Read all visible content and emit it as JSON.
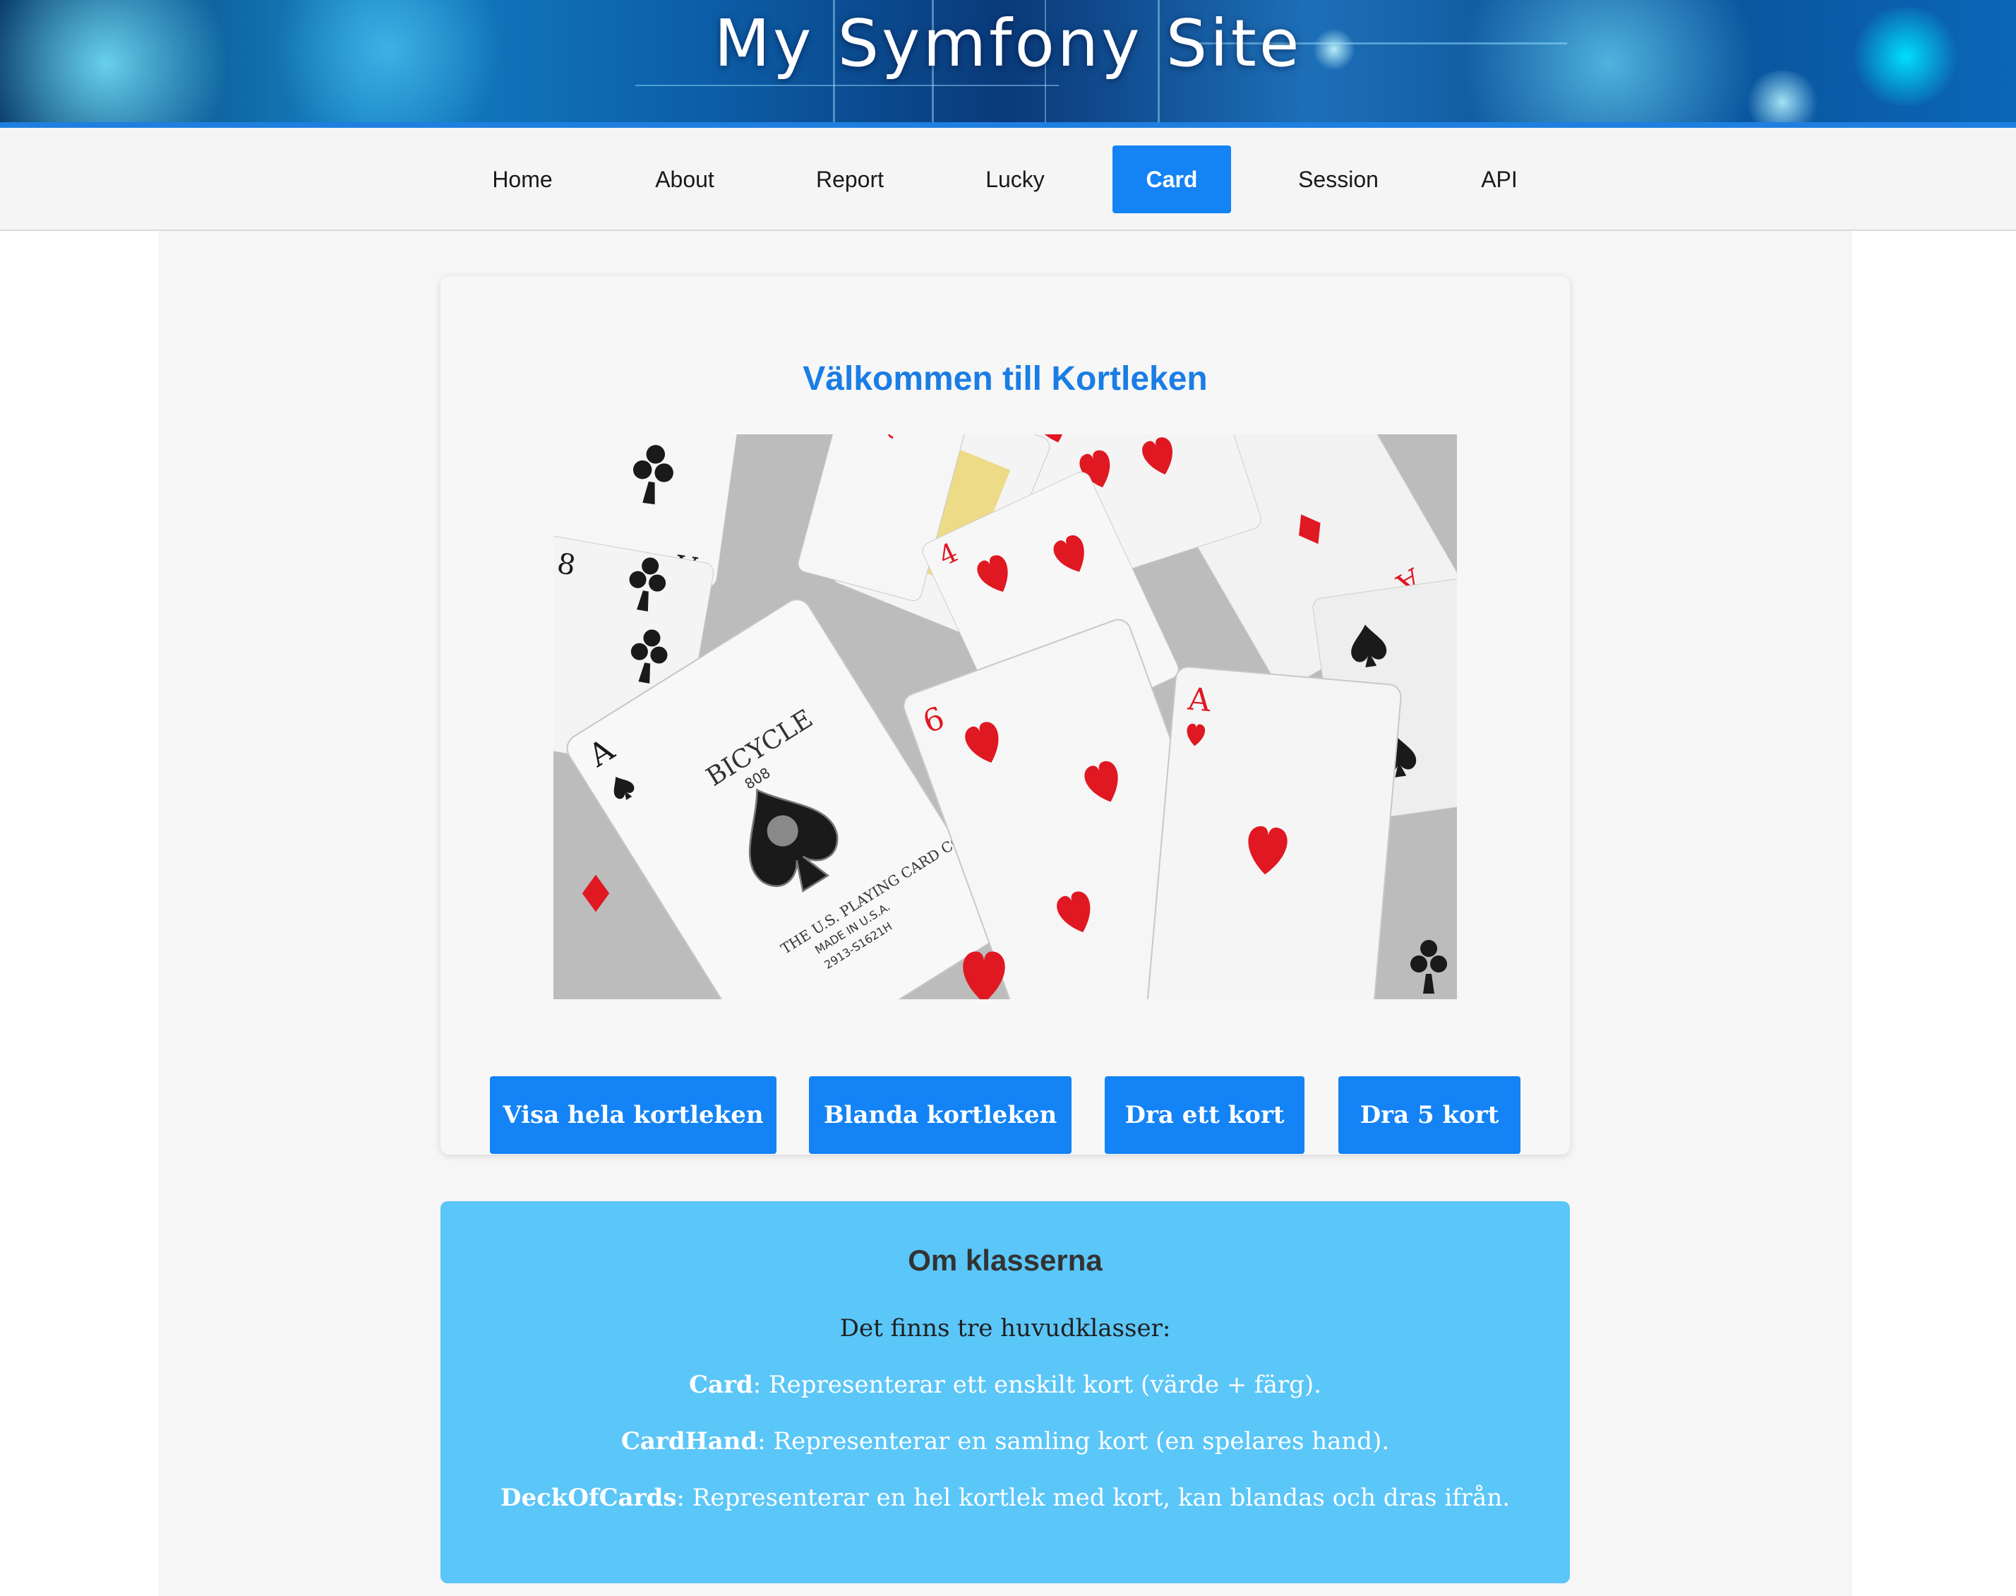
{
  "site": {
    "title": "My Symfony Site"
  },
  "nav": {
    "items": [
      {
        "label": "Home"
      },
      {
        "label": "About"
      },
      {
        "label": "Report"
      },
      {
        "label": "Lucky"
      },
      {
        "label": "Card",
        "active": true
      },
      {
        "label": "Session"
      },
      {
        "label": "API"
      }
    ]
  },
  "main": {
    "heading": "Välkommen till Kortleken",
    "image_card_text": {
      "brand": "BICYCLE",
      "model": "808",
      "maker": "THE U.S. PLAYING CARD CO.",
      "origin": "MADE IN U.S.A.",
      "code": "2913-S1621H"
    },
    "buttons": [
      {
        "label": "Visa hela kortleken"
      },
      {
        "label": "Blanda kortleken"
      },
      {
        "label": "Dra ett kort"
      },
      {
        "label": "Dra 5 kort"
      }
    ]
  },
  "info": {
    "title": "Om klasserna",
    "intro": "Det finns tre huvudklasser:",
    "classes": [
      {
        "name": "Card",
        "desc": ": Representerar ett enskilt kort (värde + färg)."
      },
      {
        "name": "CardHand",
        "desc": ": Representerar en samling kort (en spelares hand)."
      },
      {
        "name": "DeckOfCards",
        "desc": ": Representerar en hel kortlek med kort, kan blandas och dras ifrån."
      }
    ]
  },
  "colors": {
    "accent": "#1383f5",
    "heading": "#1a7de6",
    "info_bg": "#5bc6f8",
    "banner_bar": "#1f7fe0"
  }
}
